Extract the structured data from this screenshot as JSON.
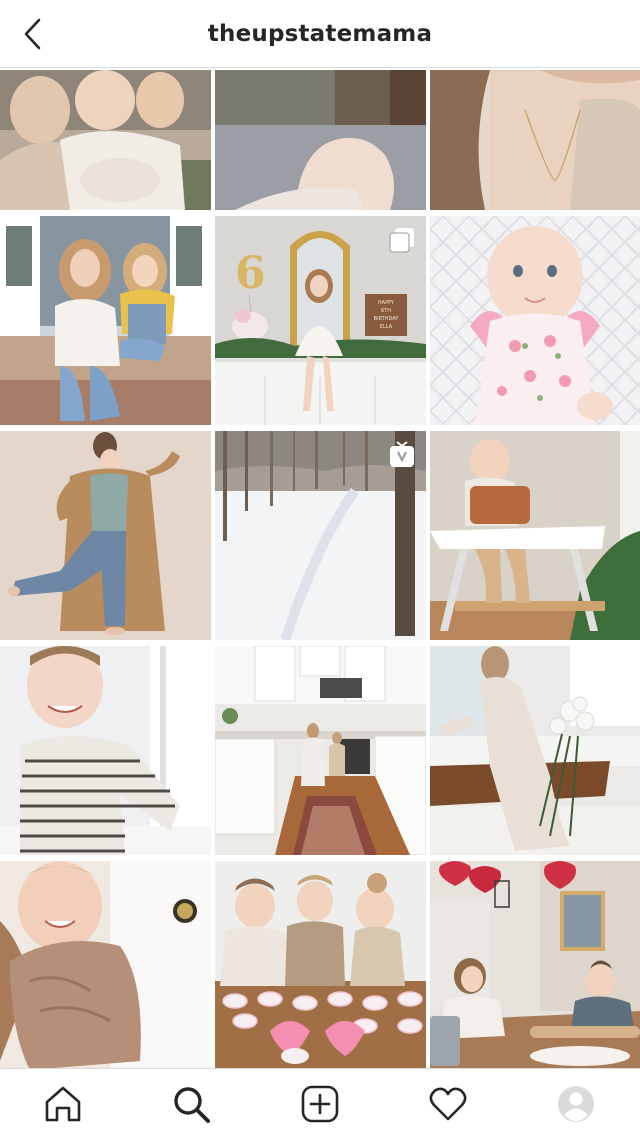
{
  "header": {
    "username": "theupstatemama",
    "back_icon": "chevron-left-icon"
  },
  "grid": {
    "posts": [
      {
        "id": "post-1",
        "subject": "three kids hugging",
        "badge": null
      },
      {
        "id": "post-2",
        "subject": "hand on pavement",
        "badge": null
      },
      {
        "id": "post-3",
        "subject": "woman with necklace",
        "badge": null
      },
      {
        "id": "post-4",
        "subject": "mother and daughter on steps",
        "badge": null
      },
      {
        "id": "post-5",
        "subject": "girl with 6 balloon birthday",
        "badge": "carousel-icon",
        "sign_text": [
          "HAPPY",
          "6TH",
          "BIRTHDAY",
          "ELLA"
        ]
      },
      {
        "id": "post-6",
        "subject": "baby in floral outfit",
        "badge": null
      },
      {
        "id": "post-7",
        "subject": "woman in camel coat",
        "badge": null
      },
      {
        "id": "post-8",
        "subject": "snowy woods",
        "badge": "igtv-icon"
      },
      {
        "id": "post-9",
        "subject": "baby in high chair",
        "badge": null
      },
      {
        "id": "post-10",
        "subject": "smiling boy in striped shirt",
        "badge": null
      },
      {
        "id": "post-11",
        "subject": "kids in white kitchen",
        "badge": null
      },
      {
        "id": "post-12",
        "subject": "girl with white roses",
        "badge": null
      },
      {
        "id": "post-13",
        "subject": "baby in towel",
        "badge": null
      },
      {
        "id": "post-14",
        "subject": "kids decorating cookies",
        "badge": null
      },
      {
        "id": "post-15",
        "subject": "kids baking with heart garland",
        "badge": null
      }
    ]
  },
  "tabbar": {
    "items": [
      {
        "name": "home",
        "icon": "home-icon"
      },
      {
        "name": "search",
        "icon": "search-icon",
        "active": true
      },
      {
        "name": "new-post",
        "icon": "add-post-icon"
      },
      {
        "name": "activity",
        "icon": "heart-icon"
      },
      {
        "name": "profile",
        "icon": "avatar-icon"
      }
    ]
  },
  "colors": {
    "text": "#262626",
    "border": "#dbdbdb",
    "background": "#ffffff"
  }
}
